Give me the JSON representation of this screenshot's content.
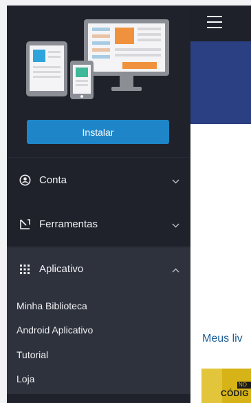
{
  "sidebar": {
    "install_label": "Instalar",
    "menu": [
      {
        "label": "Conta",
        "icon": "account-circle-icon",
        "expanded": false
      },
      {
        "label": "Ferramentas",
        "icon": "tools-icon",
        "expanded": false
      },
      {
        "label": "Aplicativo",
        "icon": "grid-dots-icon",
        "expanded": true
      }
    ],
    "submenu": [
      "Minha Biblioteca",
      "Android Aplicativo",
      "Tutorial",
      "Loja"
    ]
  },
  "main": {
    "section_title": "Meus liv",
    "book": {
      "tag": "NO",
      "title": "CÓDIG"
    }
  },
  "colors": {
    "sidebar_bg": "#1f222b",
    "active_bg": "#2e323d",
    "accent": "#1e86c8",
    "banner": "#2b3f83",
    "title": "#1a5d96"
  }
}
